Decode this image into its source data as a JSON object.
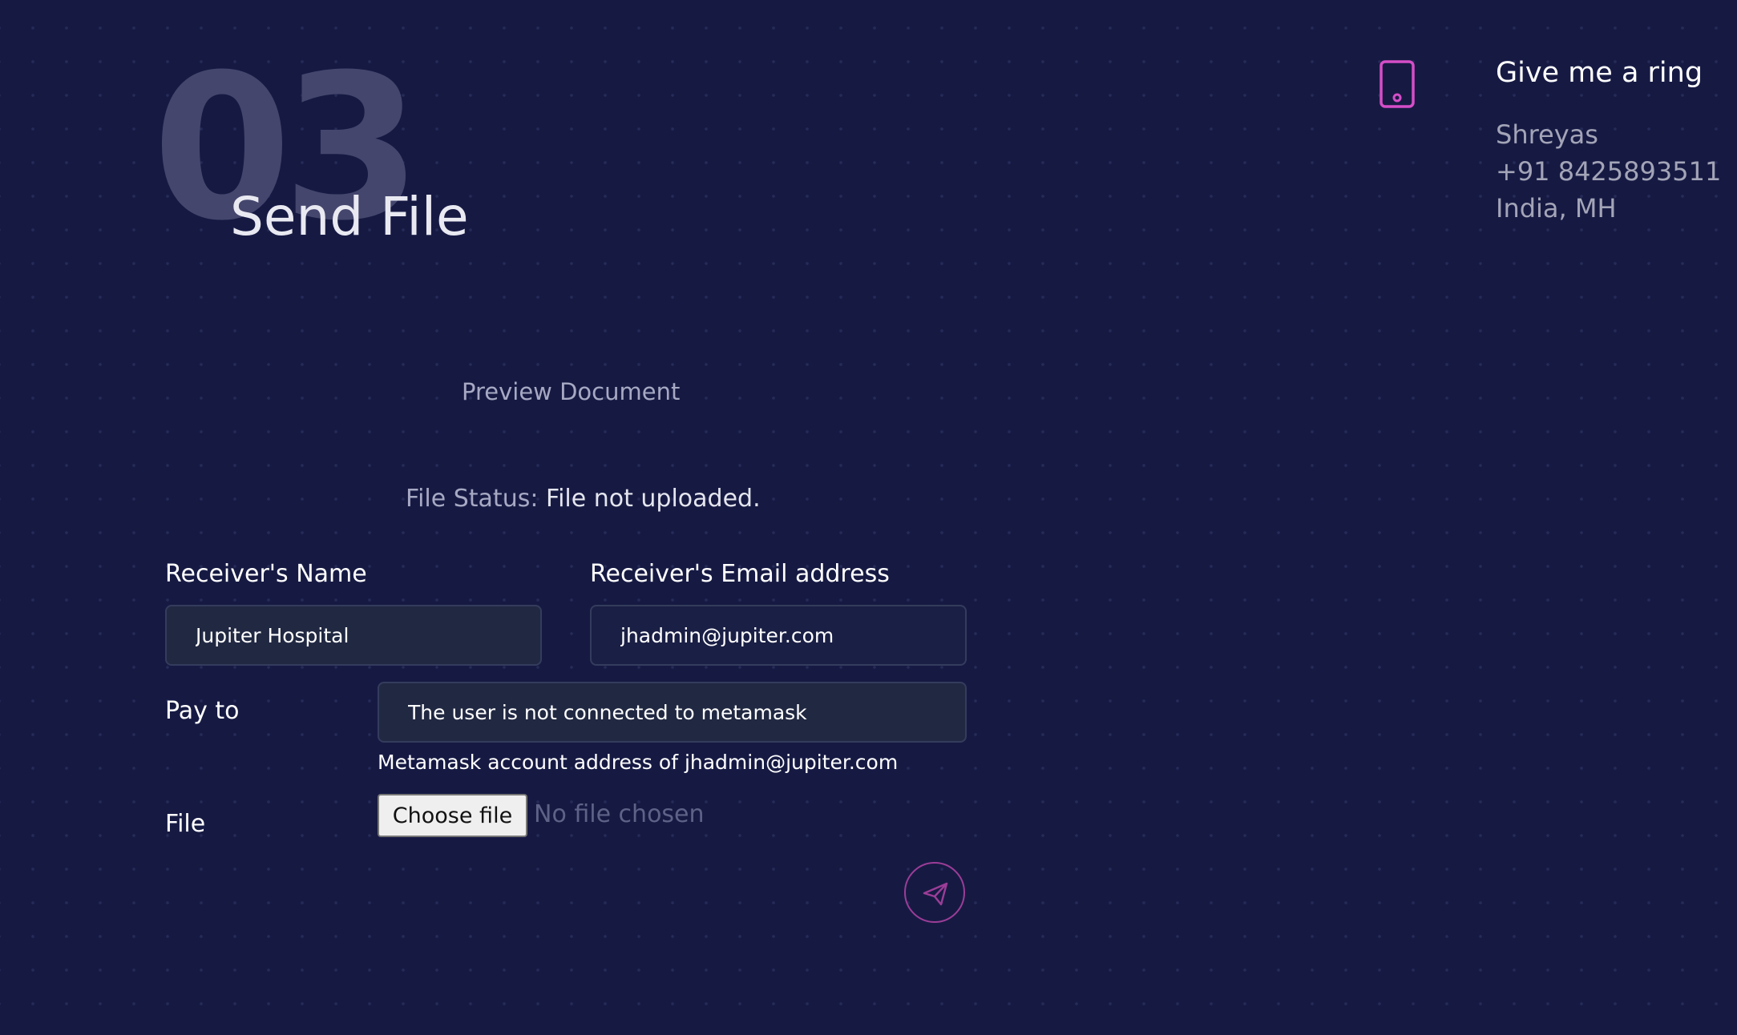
{
  "header": {
    "section_number": "03",
    "title": "Send File"
  },
  "contact": {
    "title": "Give me a ring",
    "name": "Shreyas",
    "phone": "+91 8425893511",
    "location": "India, MH",
    "icon": "phone-icon"
  },
  "preview": {
    "link_label": "Preview Document"
  },
  "status": {
    "label": "File Status:",
    "value": "File not uploaded."
  },
  "form": {
    "receiver_name": {
      "label": "Receiver's Name",
      "value": "Jupiter Hospital"
    },
    "receiver_email": {
      "label": "Receiver's Email address",
      "value": "jhadmin@jupiter.com"
    },
    "pay_to": {
      "label": "Pay to",
      "value": "The user is not connected to metamask",
      "helper": "Metamask account address of jhadmin@jupiter.com"
    },
    "file": {
      "label": "File",
      "button_label": "Choose file",
      "status_text": "No file chosen"
    },
    "submit": {
      "icon": "send-icon"
    }
  },
  "colors": {
    "background": "#161a43",
    "accent": "#d54ec8",
    "send_border": "#9c3d97",
    "input_background": "#212842"
  }
}
